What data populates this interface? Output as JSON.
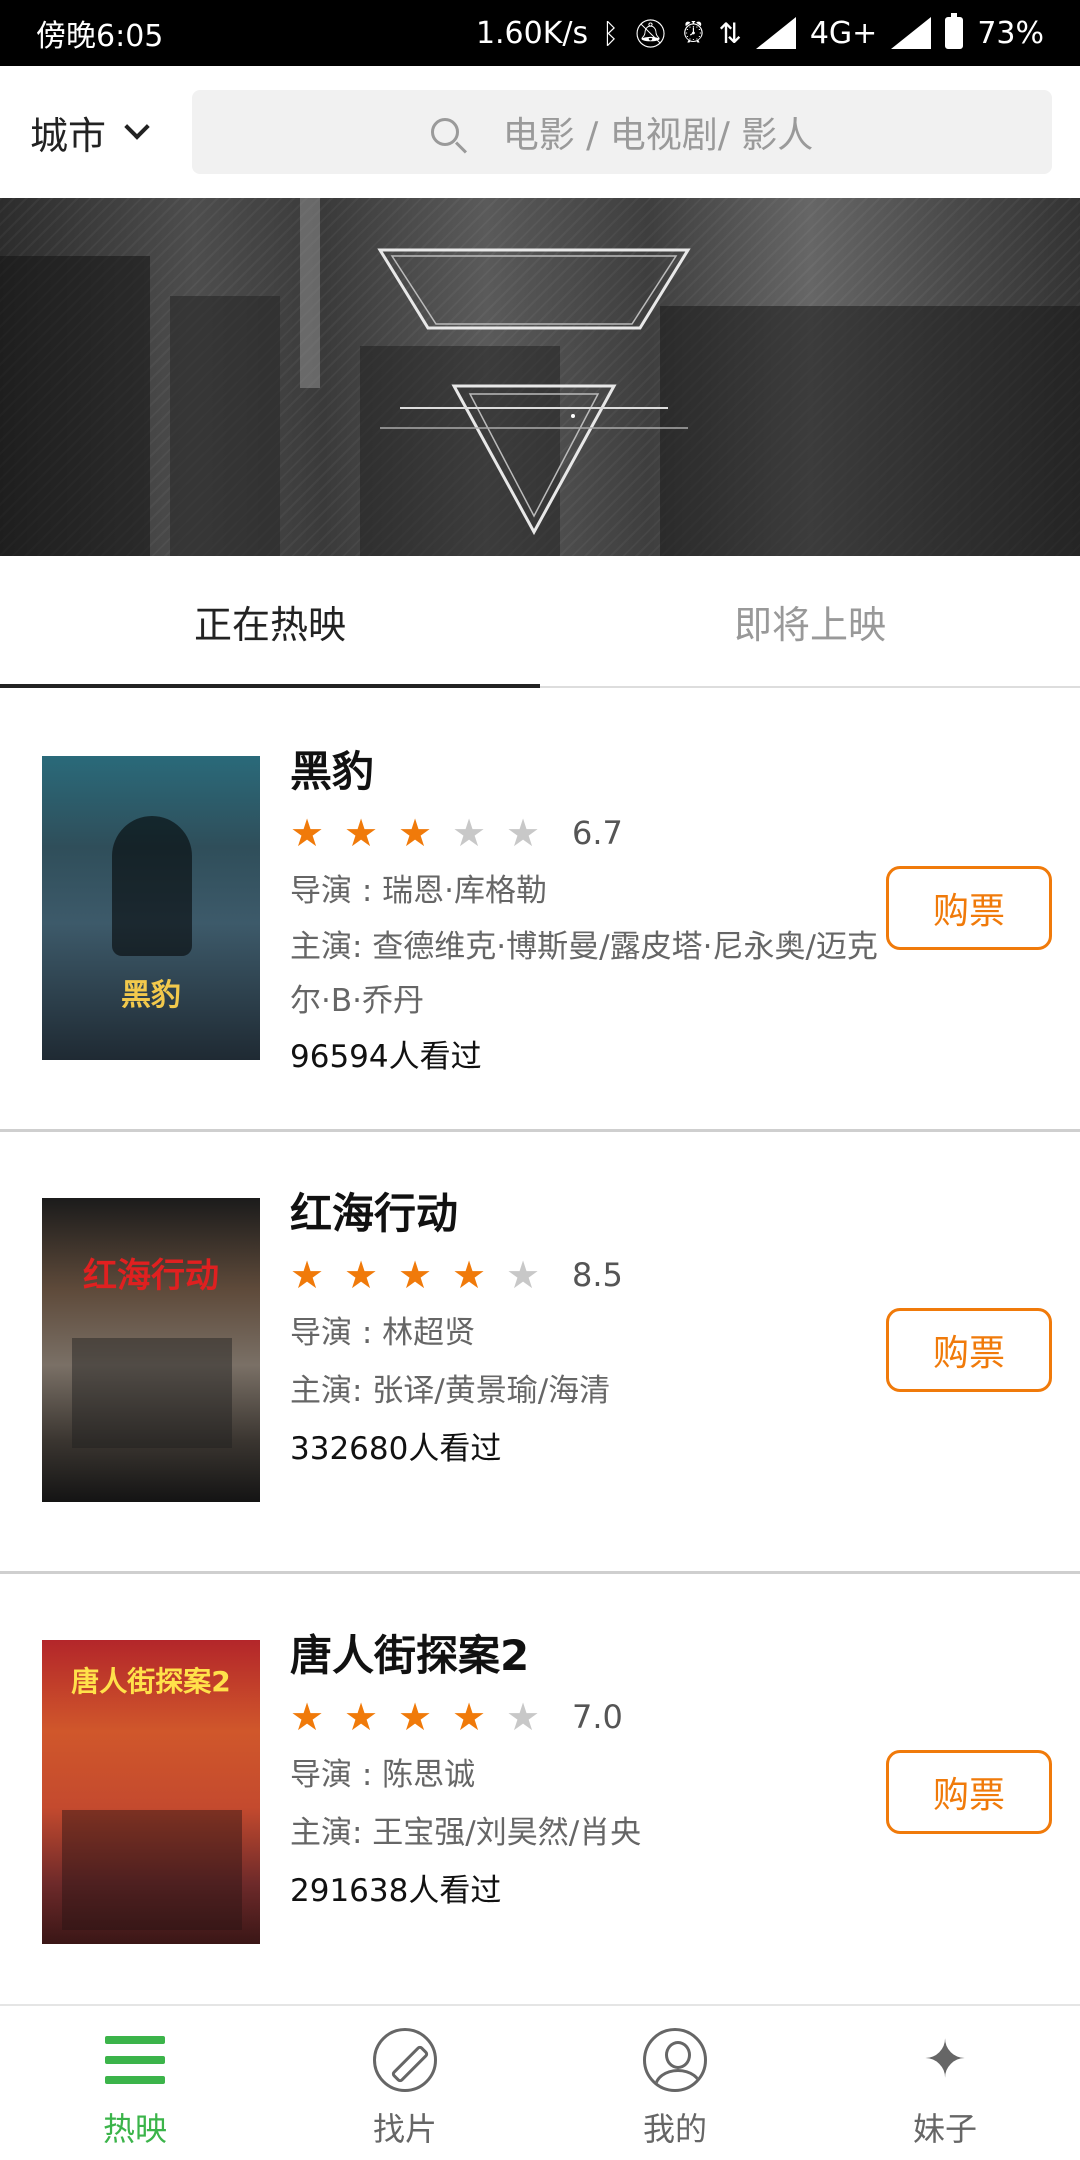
{
  "status_bar": {
    "time": "傍晚6:05",
    "speed": "1.60K/s",
    "network": "4G+",
    "battery": "73%"
  },
  "header": {
    "city_label": "城市",
    "search_placeholder": "电影 / 电视剧/ 影人"
  },
  "tabs": [
    {
      "label": "正在热映",
      "active": true
    },
    {
      "label": "即将上映",
      "active": false
    }
  ],
  "movies": [
    {
      "title": "黑豹",
      "rating_stars": 3,
      "score": "6.7",
      "director": "导演 : 瑞恩·库格勒",
      "cast": "主演: 查德维克·博斯曼/露皮塔·尼永奥/迈克尔·B·乔丹",
      "watched": "96594人看过",
      "buy_label": "购票",
      "poster_title": "黑豹"
    },
    {
      "title": "红海行动",
      "rating_stars": 4,
      "score": "8.5",
      "director": "导演 : 林超贤",
      "cast": "主演: 张译/黄景瑜/海清",
      "watched": "332680人看过",
      "buy_label": "购票",
      "poster_title": "红海行动"
    },
    {
      "title": "唐人街探案2",
      "rating_stars": 4,
      "score": "7.0",
      "director": "导演 : 陈思诚",
      "cast": "主演: 王宝强/刘昊然/肖央",
      "watched": "291638人看过",
      "buy_label": "购票",
      "poster_title": "唐人街探案2"
    }
  ],
  "bottom_nav": [
    {
      "label": "热映",
      "icon": "list-icon",
      "active": true
    },
    {
      "label": "找片",
      "icon": "compass-icon",
      "active": false
    },
    {
      "label": "我的",
      "icon": "user-icon",
      "active": false
    },
    {
      "label": "妹子",
      "icon": "star-icon",
      "active": false
    }
  ],
  "colors": {
    "accent": "#f07a0a",
    "nav_active": "#3bb44a"
  }
}
